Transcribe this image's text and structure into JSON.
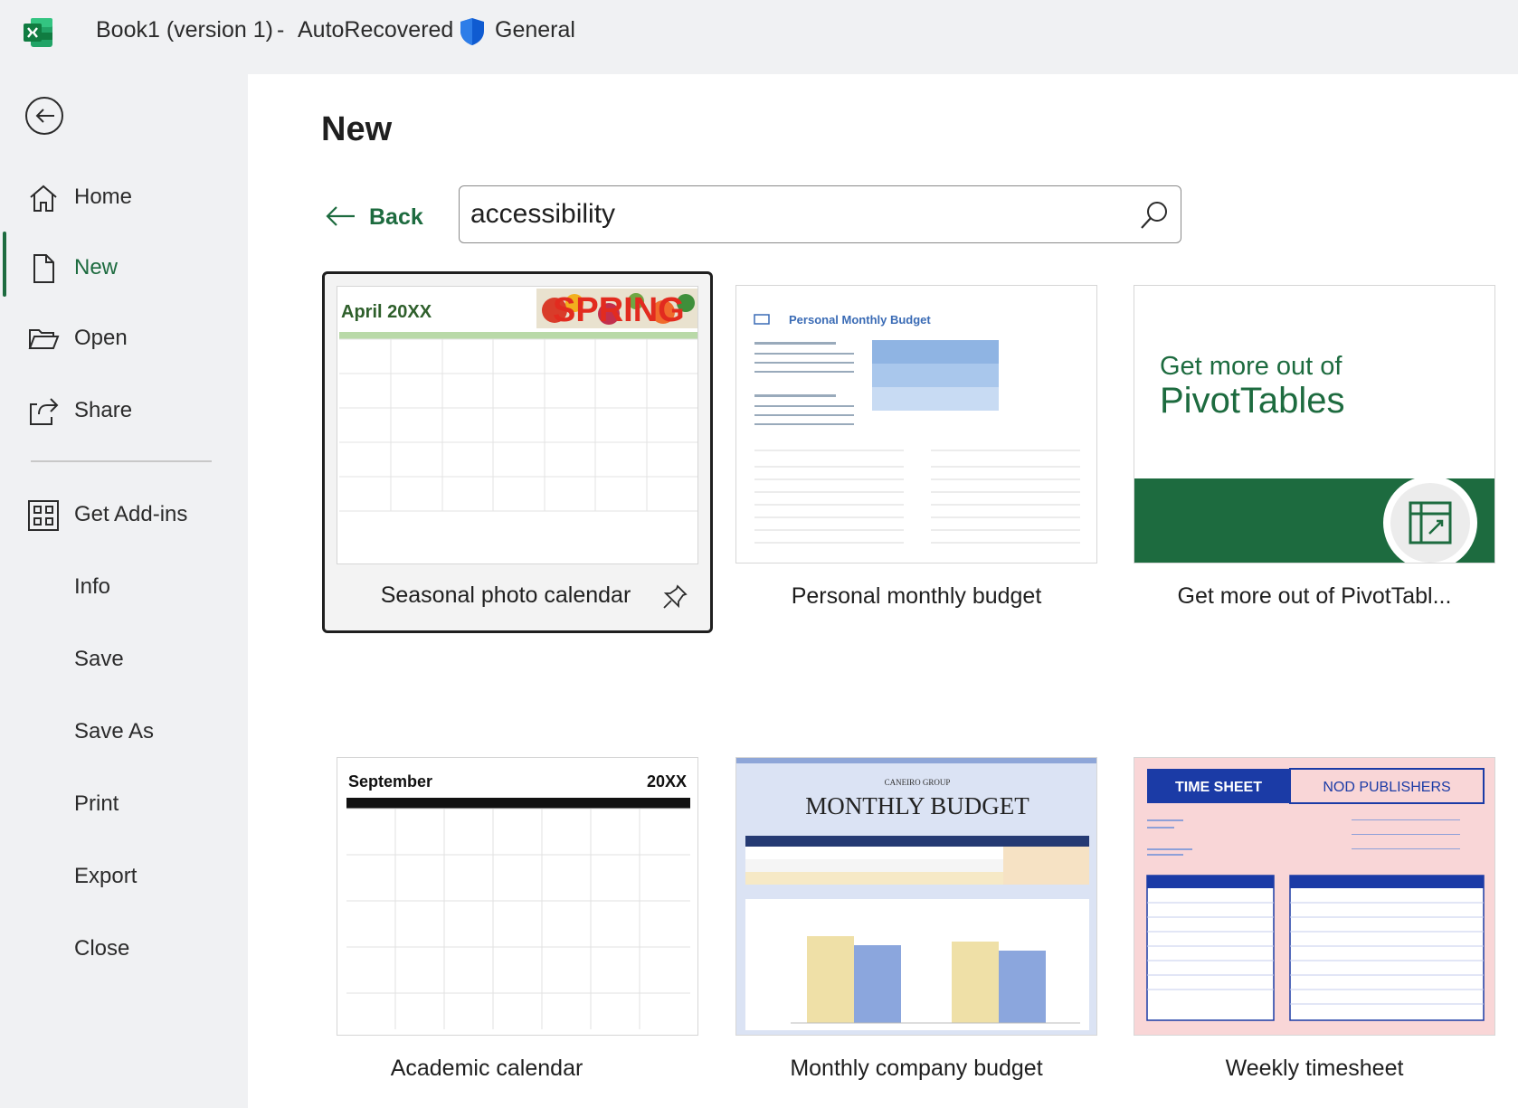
{
  "titlebar": {
    "doc_name": "Book1 (version 1)",
    "separator": "-",
    "autorecovered": "AutoRecovered",
    "sensitivity": "General"
  },
  "sidebar": {
    "items": [
      {
        "label": "Home",
        "icon": "home-icon"
      },
      {
        "label": "New",
        "icon": "new-document-icon",
        "active": true
      },
      {
        "label": "Open",
        "icon": "folder-open-icon"
      },
      {
        "label": "Share",
        "icon": "share-icon"
      },
      {
        "label": "Get Add-ins",
        "icon": "add-ins-grid-icon"
      },
      {
        "label": "Info"
      },
      {
        "label": "Save"
      },
      {
        "label": "Save As"
      },
      {
        "label": "Print"
      },
      {
        "label": "Export"
      },
      {
        "label": "Close"
      }
    ]
  },
  "main": {
    "title": "New",
    "back_label": "Back",
    "search": {
      "value": "accessibility"
    }
  },
  "templates": [
    {
      "label": "Seasonal photo calendar",
      "thumb_title": "April 20XX",
      "thumb_banner": "SPRING"
    },
    {
      "label": "Personal monthly budget",
      "thumb_title": "Personal Monthly Budget"
    },
    {
      "label": "Get more out of PivotTabl...",
      "thumb_line1": "Get more out of",
      "thumb_line2": "PivotTables"
    },
    {
      "label": "Academic calendar",
      "thumb_month": "September",
      "thumb_year": "20XX"
    },
    {
      "label": "Monthly company budget",
      "thumb_company": "CANEIRO GROUP",
      "thumb_title": "MONTHLY BUDGET"
    },
    {
      "label": "Weekly timesheet",
      "thumb_left": "TIME SHEET",
      "thumb_right": "NOD PUBLISHERS"
    }
  ],
  "colors": {
    "accent_green": "#1d6b3f",
    "excel_green": "#107c41",
    "shield_blue": "#0f5bd1"
  }
}
